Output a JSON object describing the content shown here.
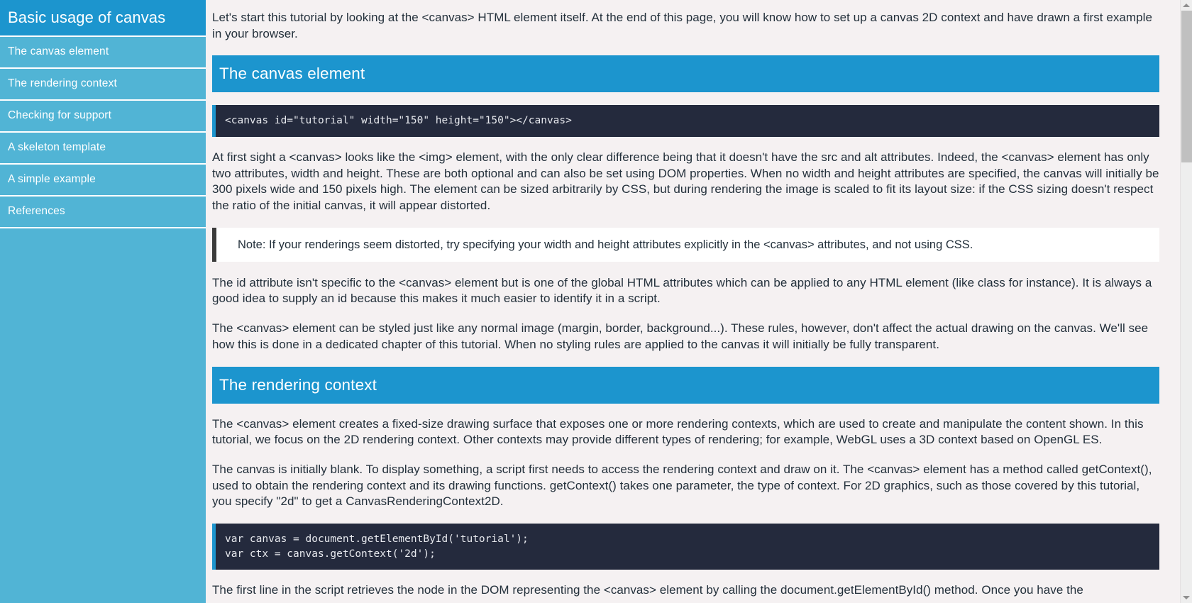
{
  "sidebar": {
    "title": "Basic usage of canvas",
    "items": [
      {
        "label": "The canvas element"
      },
      {
        "label": "The rendering context"
      },
      {
        "label": "Checking for support"
      },
      {
        "label": "A skeleton template"
      },
      {
        "label": "A simple example"
      },
      {
        "label": "References"
      }
    ]
  },
  "main": {
    "intro_paragraph": "Let's start this tutorial by looking at the <canvas> HTML element itself. At the end of this page, you will know how to set up a canvas 2D context and have drawn a first example in your browser.",
    "sections": [
      {
        "heading": "The canvas element",
        "code": "<canvas id=\"tutorial\" width=\"150\" height=\"150\"></canvas>",
        "paragraph_1": "At first sight a <canvas> looks like the <img> element, with the only clear difference being that it doesn't have the src and alt attributes. Indeed, the <canvas> element has only two attributes, width and height. These are both optional and can also be set using DOM properties. When no width and height attributes are specified, the canvas will initially be 300 pixels wide and 150 pixels high. The element can be sized arbitrarily by CSS, but during rendering the image is scaled to fit its layout size: if the CSS sizing doesn't respect the ratio of the initial canvas, it will appear distorted.",
        "note": "Note: If your renderings seem distorted, try specifying your width and height attributes explicitly in the <canvas> attributes, and not using CSS.",
        "paragraph_2": "The id attribute isn't specific to the <canvas> element but is one of the global HTML attributes which can be applied to any HTML element (like class for instance). It is always a good idea to supply an id because this makes it much easier to identify it in a script.",
        "paragraph_3": "The <canvas> element can be styled just like any normal image (margin, border, background...). These rules, however, don't affect the actual drawing on the canvas. We'll see how this is done in a dedicated chapter of this tutorial. When no styling rules are applied to the canvas it will initially be fully transparent."
      },
      {
        "heading": "The rendering context",
        "paragraph_1": "The <canvas> element creates a fixed-size drawing surface that exposes one or more rendering contexts, which are used to create and manipulate the content shown. In this tutorial, we focus on the 2D rendering context. Other contexts may provide different types of rendering; for example, WebGL uses a 3D context based on OpenGL ES.",
        "paragraph_2": "The canvas is initially blank. To display something, a script first needs to access the rendering context and draw on it. The <canvas> element has a method called getContext(), used to obtain the rendering context and its drawing functions. getContext() takes one parameter, the type of context. For 2D graphics, such as those covered by this tutorial, you specify \"2d\" to get a CanvasRenderingContext2D.",
        "code": "var canvas = document.getElementById('tutorial');\nvar ctx = canvas.getContext('2d');",
        "paragraph_3": "The first line in the script retrieves the node in the DOM representing the <canvas> element by calling the document.getElementById() method. Once you have the"
      }
    ]
  },
  "scrollbar": {
    "up_arrow": "triangle-up-icon",
    "down_arrow": "triangle-down-icon"
  },
  "colors": {
    "sidebar_bg": "#51b4d5",
    "accent_blue": "#1c95ce",
    "code_bg": "#242a3d",
    "page_bg": "#f5f1f2",
    "note_border": "#3b3b3b"
  }
}
